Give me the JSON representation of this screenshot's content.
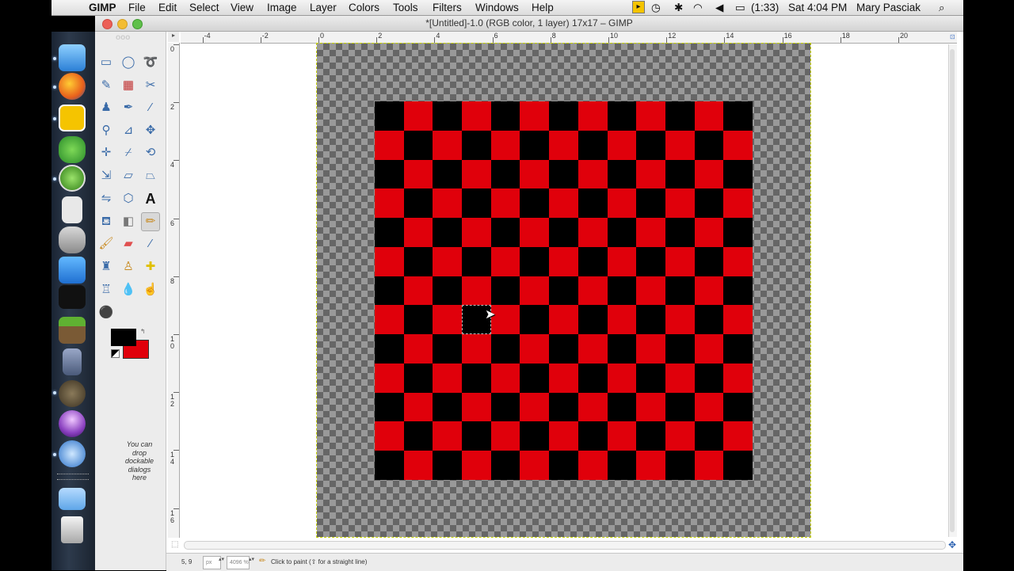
{
  "menubar": {
    "app": "GIMP",
    "items": [
      "File",
      "Edit",
      "Select",
      "View",
      "Image",
      "Layer",
      "Colors",
      "Tools",
      "Filters",
      "Windows",
      "Help"
    ],
    "battery": "(1:33)",
    "clock": "Sat 4:04 PM",
    "user": "Mary Pasciak"
  },
  "window": {
    "title": "*[Untitled]-1.0 (RGB color, 1 layer) 17x17 – GIMP"
  },
  "toolbox": {
    "dock_hint": "You can drop dockable dialogs here",
    "fg_color": "#000000",
    "bg_color": "#e0000b"
  },
  "ruler": {
    "h_labels": [
      "-4",
      "-2",
      "0",
      "2",
      "4",
      "6",
      "8",
      "10",
      "12",
      "14",
      "16",
      "18",
      "20"
    ],
    "v_labels": [
      "0",
      "2",
      "4",
      "6",
      "8",
      "10",
      "12",
      "14",
      "16"
    ]
  },
  "board": {
    "rows": 13,
    "cols": 13,
    "dark": "#000000",
    "light": "#e0000b",
    "selected_cell": [
      7,
      3
    ]
  },
  "statusbar": {
    "coords": "5, 9",
    "unit": "px",
    "zoom": "4096 %",
    "message": "Click to paint (⇧ for a straight line)"
  },
  "dock_apps": [
    "Finder",
    "Firefox",
    "Sprint",
    "Network",
    "Clock",
    "Calculator",
    "Database",
    "Word",
    "Amazon MP3",
    "Minecraft",
    "Agent",
    "GIMP",
    "Orb",
    "QuickTime",
    "Folder",
    "Trash"
  ]
}
